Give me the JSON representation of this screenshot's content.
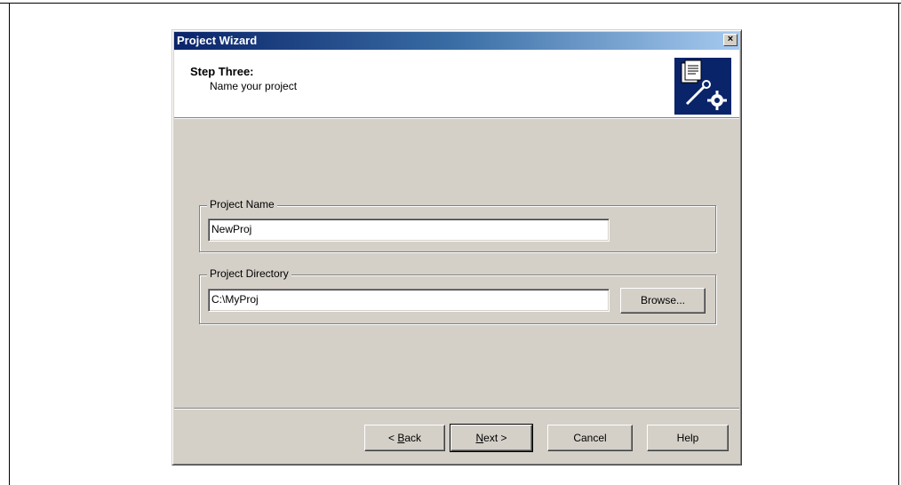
{
  "window": {
    "title": "Project Wizard",
    "close_label": "×"
  },
  "header": {
    "step_title": "Step Three:",
    "step_subtitle": "Name your project",
    "icon": "project-wizard-icon"
  },
  "project_name": {
    "legend": "Project Name",
    "value": "NewProj"
  },
  "project_directory": {
    "legend": "Project Directory",
    "value": "C:\\MyProj",
    "browse_label": "Browse..."
  },
  "buttons": {
    "back_prefix": "< ",
    "back_mnemonic": "B",
    "back_rest": "ack",
    "next_mnemonic": "N",
    "next_rest": "ext >",
    "cancel_label": "Cancel",
    "help_label": "Help"
  }
}
